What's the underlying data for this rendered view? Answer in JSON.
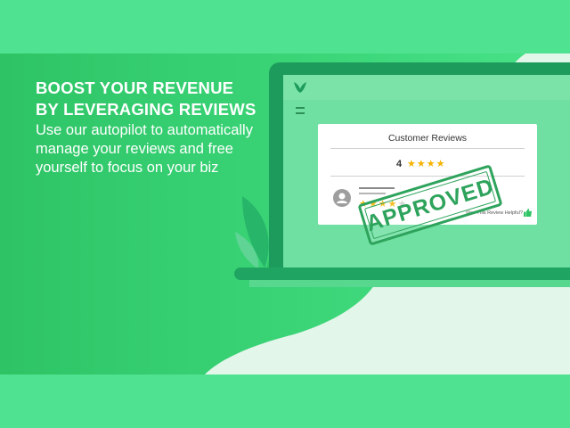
{
  "headline": "BOOST  YOUR REVENUE\nBY LEVERAGING REVIEWS",
  "body": "Use our autopilot to automatically manage your reviews and free yourself to focus on your biz",
  "widget": {
    "title": "Customer Reviews",
    "average_rating": "4",
    "summary_stars": "★★★★",
    "review_stars_on": "★★★★",
    "review_stars_off": "★",
    "helpful_text": "Was This Review Helpful?",
    "stamp": "APPROVED"
  },
  "icons": {
    "logo": "leaf-logo-icon",
    "menu": "menu-icon",
    "avatar": "user-avatar-icon",
    "thumbs": "thumbs-up-icon"
  },
  "colors": {
    "brand_green": "#2ec466",
    "light_green": "#4fe290",
    "dark_green": "#1d9b5c",
    "star": "#f5b301"
  }
}
